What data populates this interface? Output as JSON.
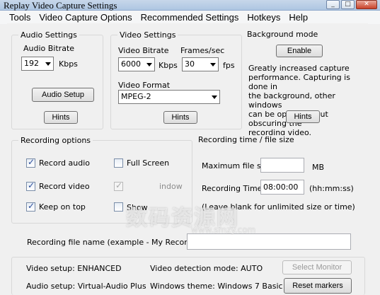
{
  "window": {
    "title": "Replay Video Capture Settings"
  },
  "menu": [
    "Tools",
    "Video Capture Options",
    "Recommended Settings",
    "Hotkeys",
    "Help"
  ],
  "audio": {
    "legend": "Audio Settings",
    "bitrate_label": "Audio Bitrate",
    "bitrate_value": "192",
    "unit": "Kbps",
    "setup_button": "Audio Setup",
    "hints_button": "Hints"
  },
  "video": {
    "legend": "Video Settings",
    "bitrate_label": "Video Bitrate",
    "bitrate_value": "6000",
    "bitrate_unit": "Kbps",
    "fps_label": "Frames/sec",
    "fps_value": "30",
    "fps_unit": "fps",
    "format_label": "Video Format",
    "format_value": "MPEG-2",
    "hints_button": "Hints"
  },
  "background": {
    "legend": "Background mode",
    "enable_button": "Enable",
    "description": [
      "Greatly increased capture",
      "performance. Capturing is done in",
      "the background, other windows",
      "can be open without obscuring the",
      "recording video."
    ],
    "hints_button": "Hints"
  },
  "recording_options": {
    "legend": "Recording options",
    "items": [
      {
        "label": "Record audio",
        "checked": true
      },
      {
        "label": "Record video",
        "checked": true
      },
      {
        "label": "Keep on top",
        "checked": true
      },
      {
        "label": "Full Screen",
        "checked": false
      },
      {
        "label": "indow",
        "checked": true,
        "disabled": true
      },
      {
        "label": "Show",
        "checked": false
      }
    ]
  },
  "recording_time": {
    "legend": "Recording time / file size",
    "max_size_label": "Maximum file size",
    "max_size_value": "",
    "max_size_unit": "MB",
    "time_label": "Recording Time",
    "time_value": "08:00:00",
    "time_format": "(hh:mm:ss)",
    "note": "(Leave blank for unlimited size or time)"
  },
  "filename": {
    "label": "Recording file name (example -  My Recording)",
    "value": ""
  },
  "status": {
    "video_setup": "Video setup: ENHANCED",
    "audio_setup": "Audio setup: Virtual-Audio Plus",
    "detection_mode": "Video detection mode: AUTO",
    "windows_theme": "Windows theme: Windows 7 Basic",
    "select_monitor_button": "Select Monitor",
    "reset_markers_button": "Reset markers"
  },
  "watermark": {
    "main": "数码资源网",
    "sub": "www.smzy.com"
  }
}
